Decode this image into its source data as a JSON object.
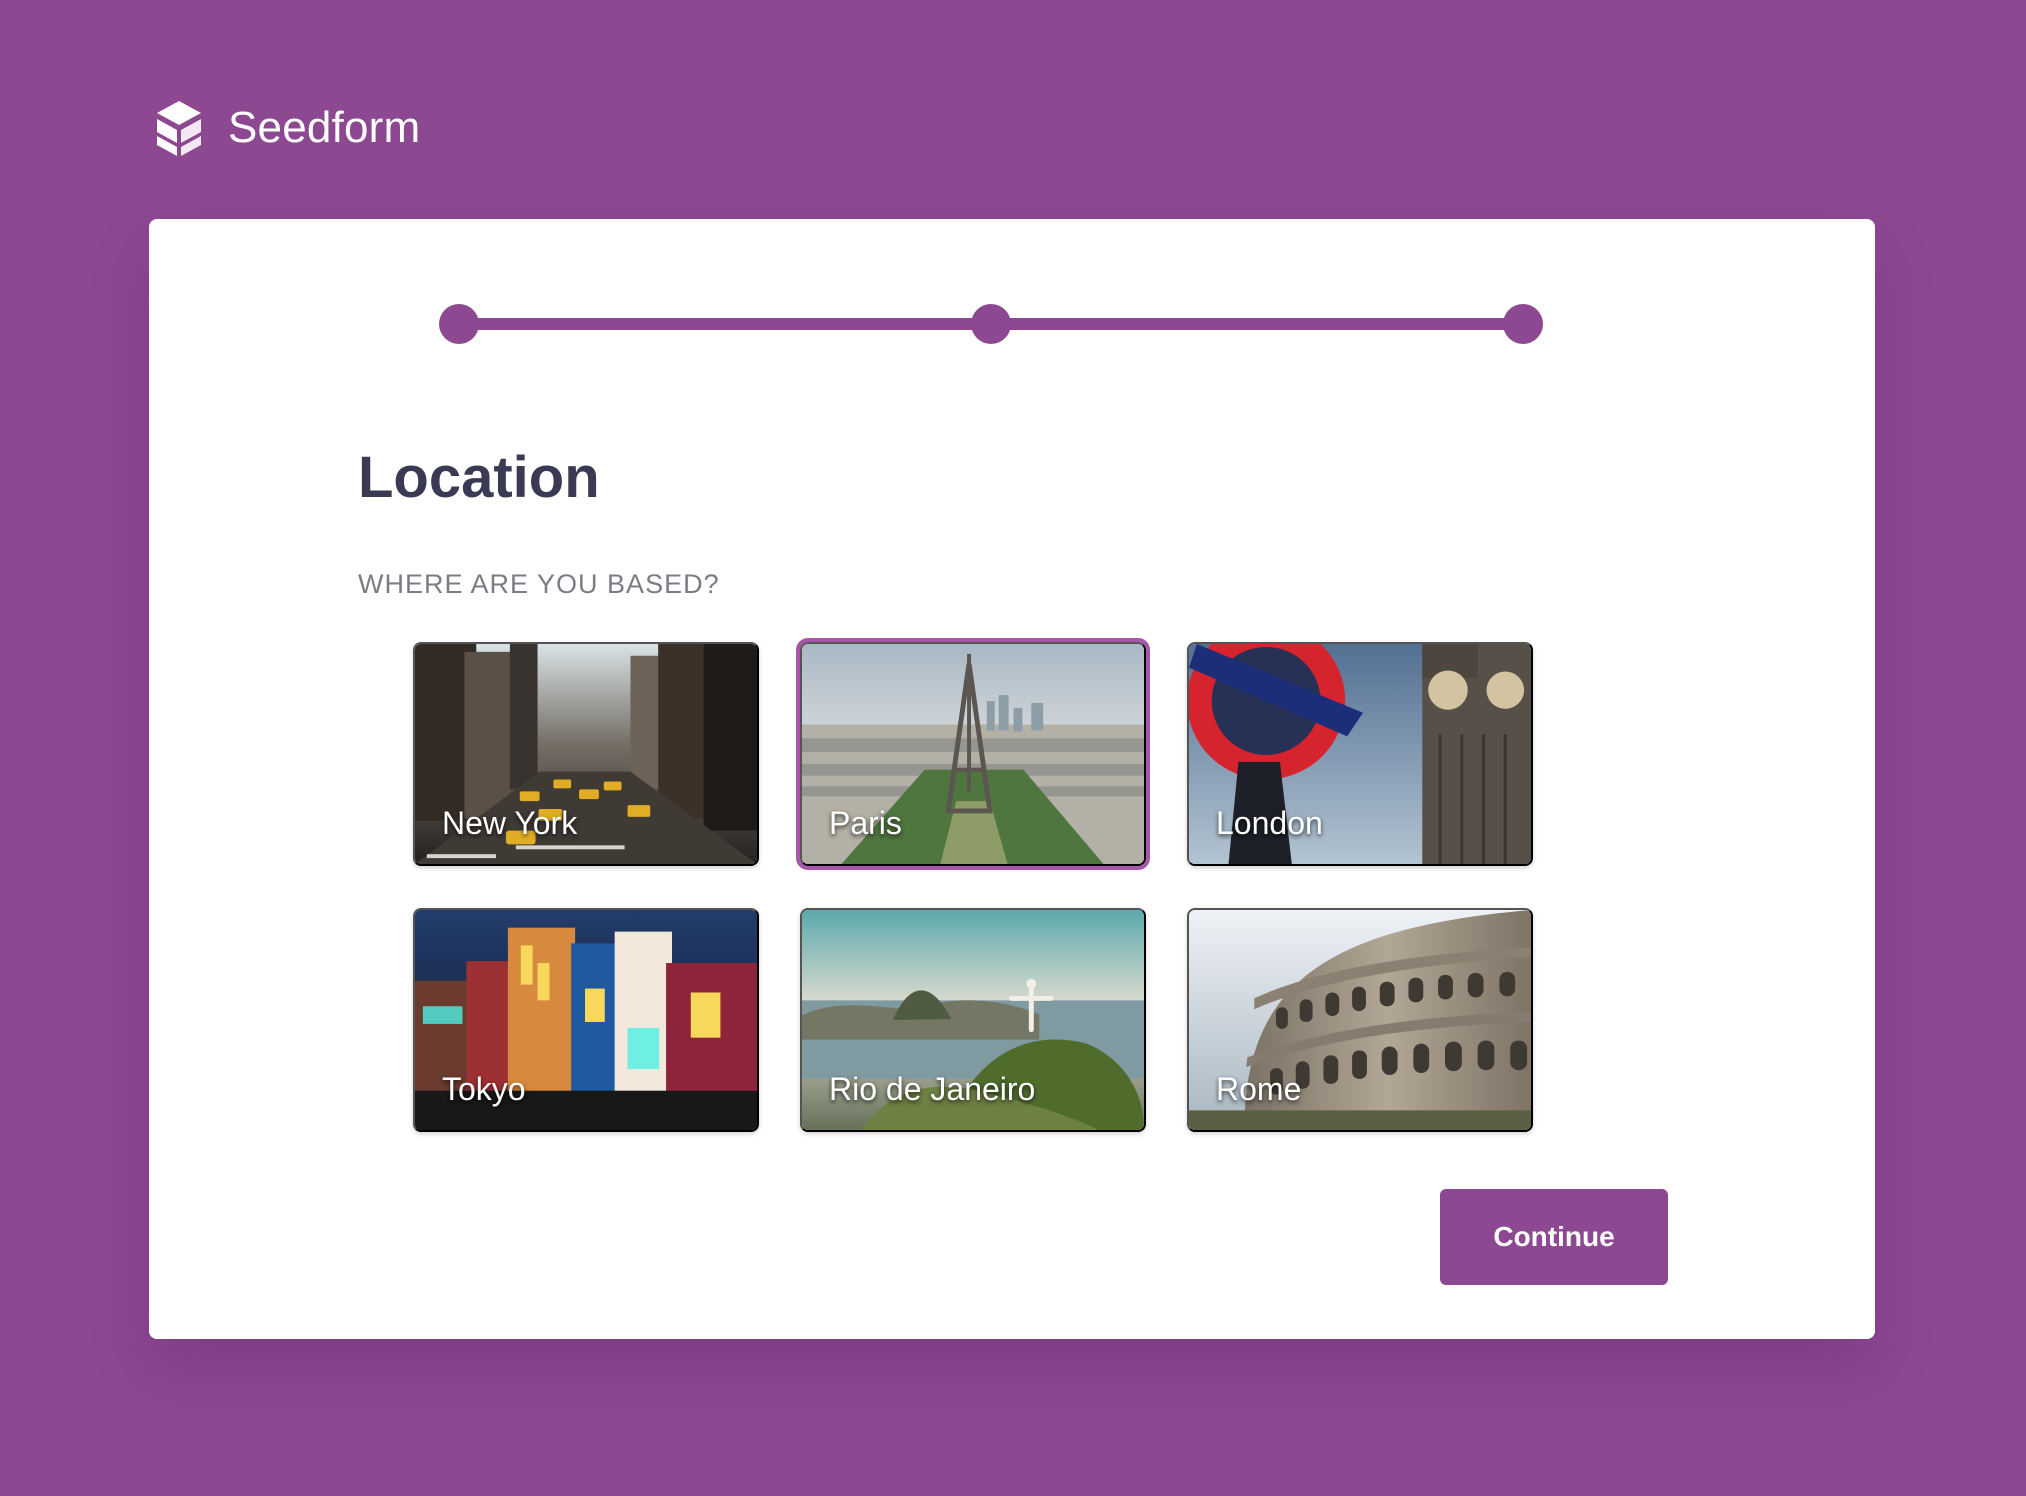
{
  "brand": {
    "name": "Seedform",
    "logo_icon": "stacked-cubes-icon"
  },
  "colors": {
    "brand_purple": "#8d4892",
    "selected_outline": "#a657aa",
    "heading": "#3b3a55",
    "subheading": "#7c7c85",
    "card_background": "#ffffff"
  },
  "progress": {
    "steps_total": 3,
    "completed_fraction": 1
  },
  "main": {
    "title": "Location",
    "question": "WHERE ARE YOU BASED?",
    "selected_city": "Paris"
  },
  "cities": [
    {
      "label": "New York",
      "icon": "city-street-photo",
      "selected": false
    },
    {
      "label": "Paris",
      "icon": "eiffel-tower-photo",
      "selected": true
    },
    {
      "label": "London",
      "icon": "underground-big-ben-photo",
      "selected": false
    },
    {
      "label": "Tokyo",
      "icon": "neon-district-photo",
      "selected": false
    },
    {
      "label": "Rio de Janeiro",
      "icon": "christ-redeemer-photo",
      "selected": false
    },
    {
      "label": "Rome",
      "icon": "colosseum-photo",
      "selected": false
    }
  ],
  "actions": {
    "continue_label": "Continue"
  }
}
